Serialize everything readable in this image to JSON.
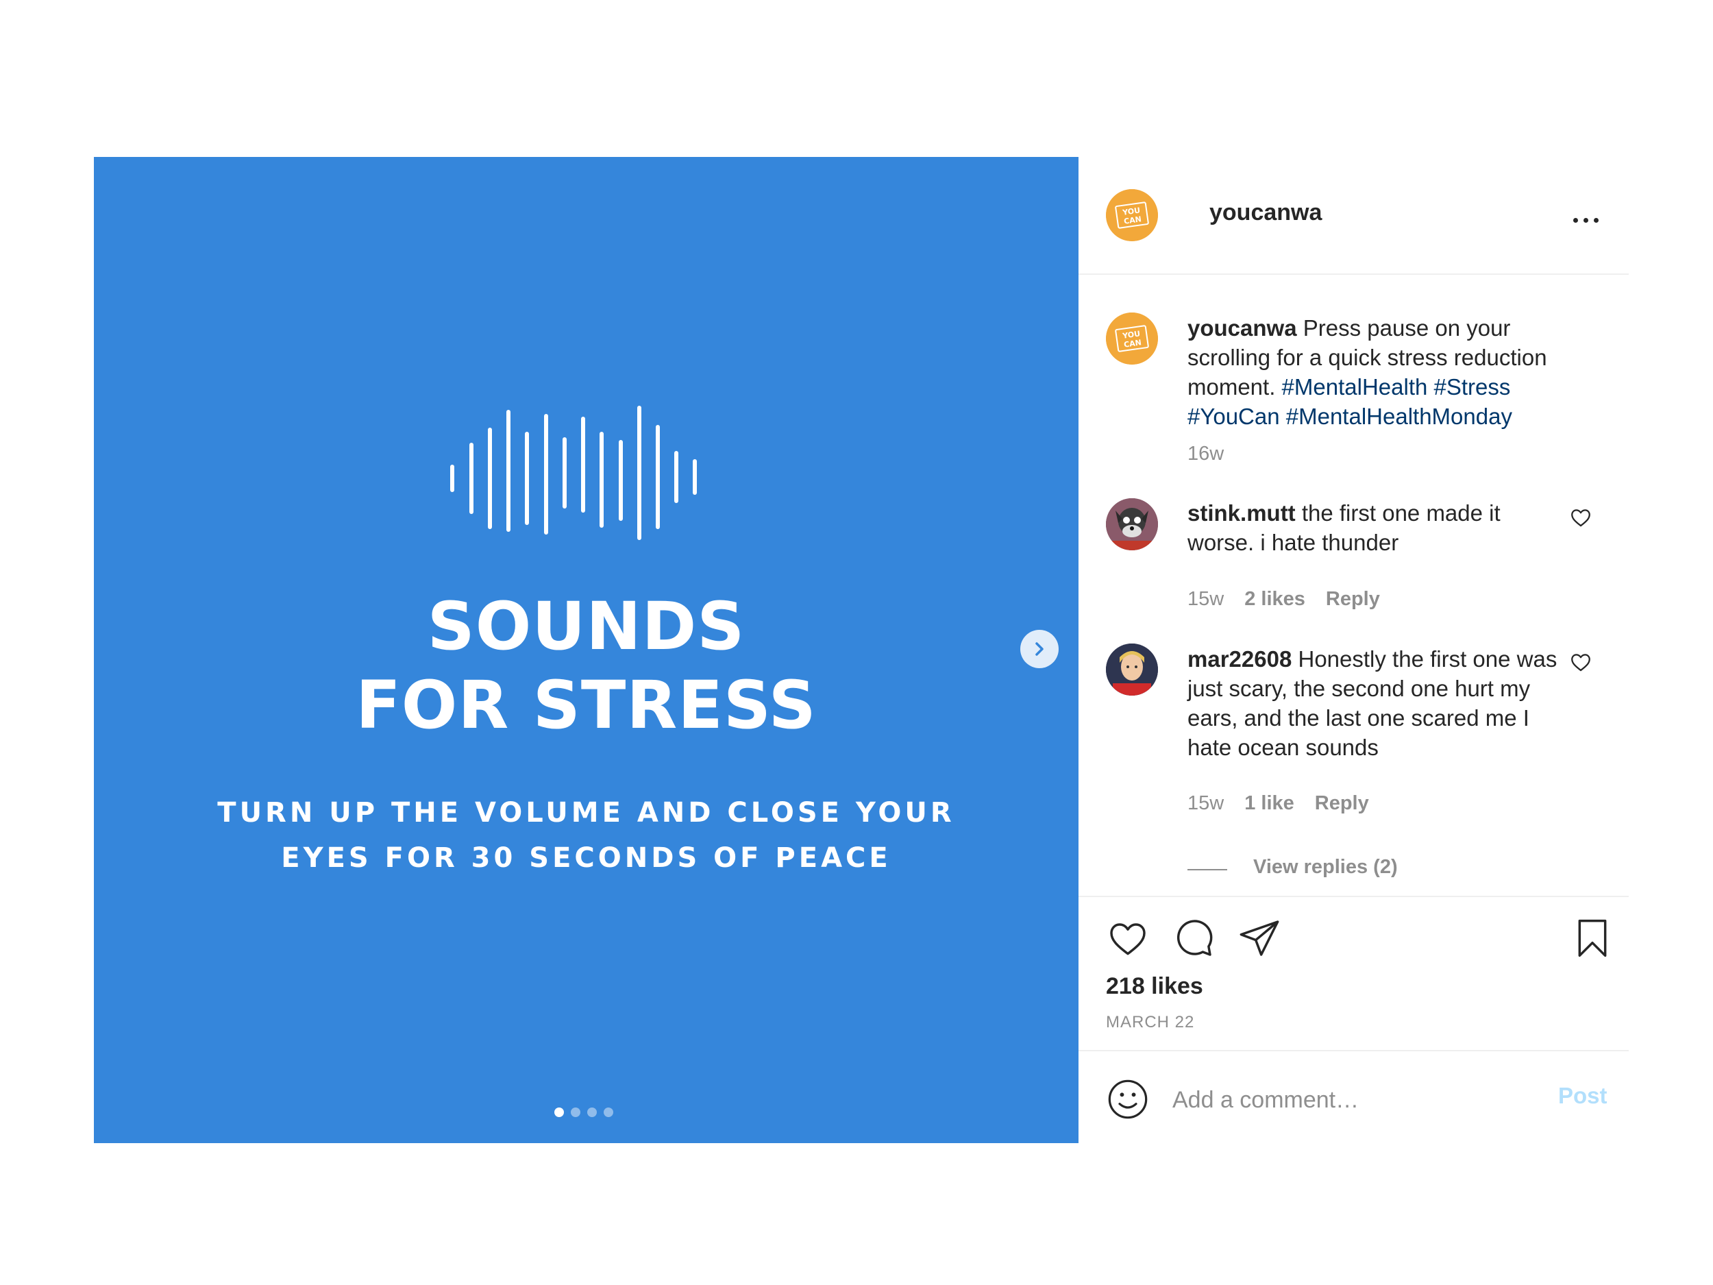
{
  "media": {
    "waveform_icon": "waveform-icon",
    "title_line1": "SOUNDS",
    "title_line2": "FOR STRESS",
    "subtitle_line1": "TURN UP THE VOLUME AND CLOSE YOUR",
    "subtitle_line2": "EYES FOR 30 SECONDS OF PEACE",
    "carousel_total": 4,
    "carousel_current": 1,
    "background_color": "#3586db"
  },
  "header": {
    "avatar_text_1": "YOU",
    "avatar_text_2": "CAN",
    "username": "youcanwa",
    "more_icon": "more-options-icon"
  },
  "caption": {
    "username": "youcanwa",
    "text": "Press pause on your scrolling for a quick stress reduction moment.",
    "hashtags": [
      "#MentalHealth",
      "#Stress",
      "#YouCan",
      "#MentalHealthMonday"
    ],
    "time": "16w"
  },
  "comments": [
    {
      "username": "stink.mutt",
      "text": "the first one made it worse. i hate thunder",
      "time": "15w",
      "likes": "2 likes",
      "reply": "Reply"
    },
    {
      "username": "mar22608",
      "text": "Honestly the first one was just scary, the second one hurt my ears, and the last one scared me I hate ocean sounds",
      "time": "15w",
      "likes": "1 like",
      "reply": "Reply",
      "view_replies": "View replies (2)"
    }
  ],
  "actions": {
    "likes": "218 likes",
    "date": "MARCH 22"
  },
  "add_comment": {
    "placeholder": "Add a comment…",
    "post_label": "Post"
  },
  "colors": {
    "accent_brand": "#f2a83a",
    "hashtag": "#00376b",
    "post_button_disabled": "#b2dffc"
  }
}
